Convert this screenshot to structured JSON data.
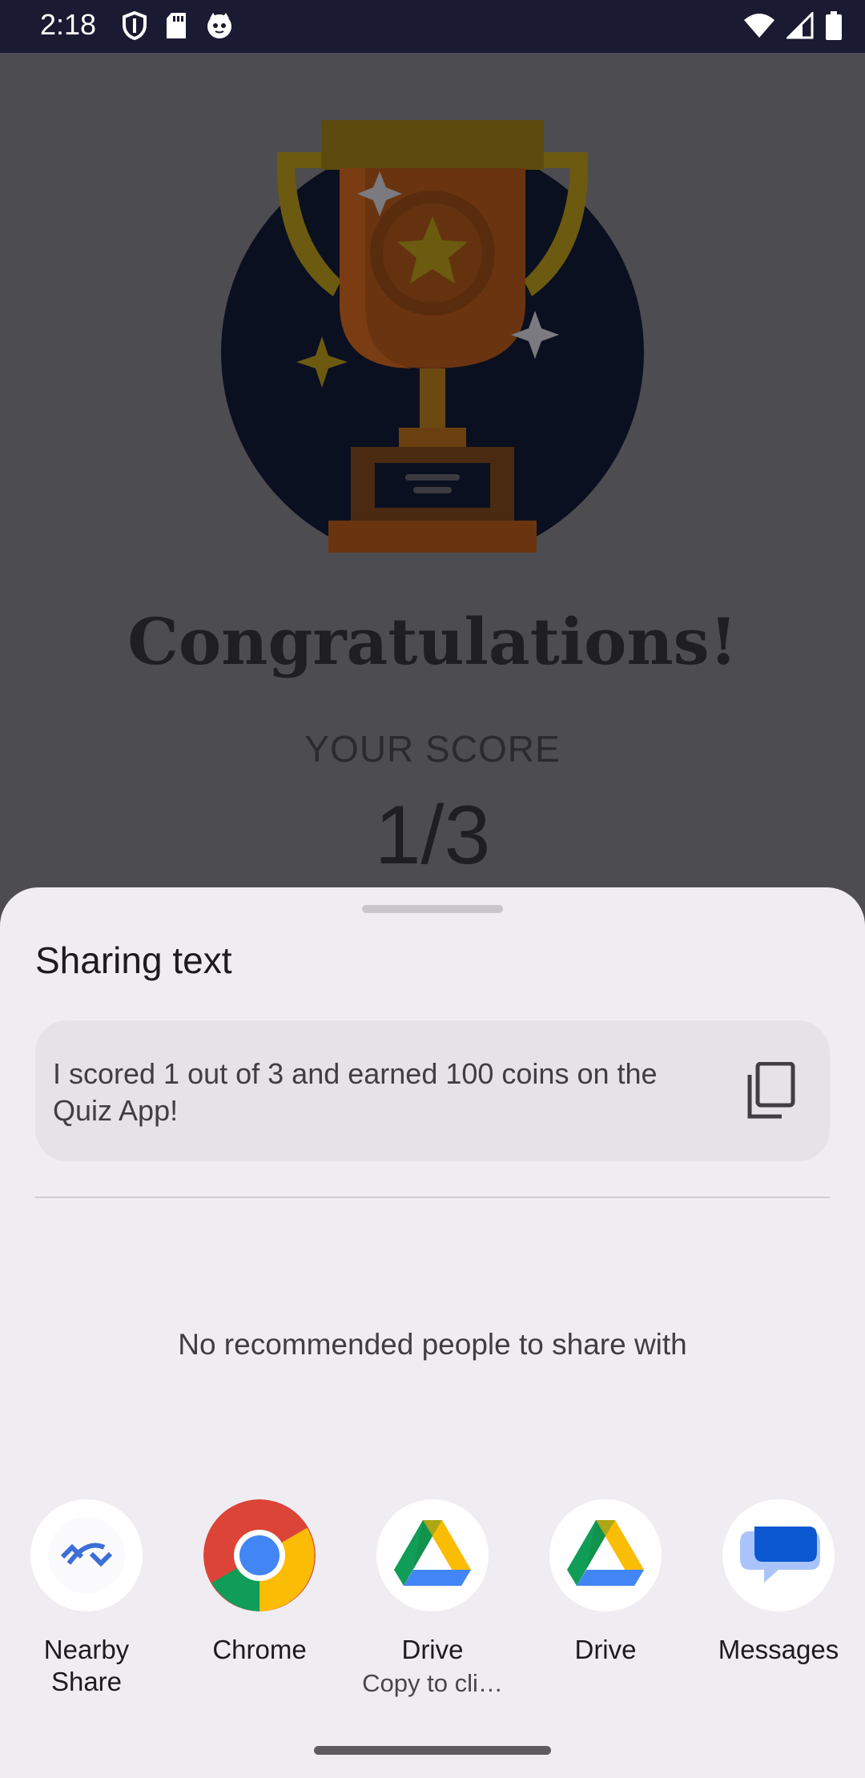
{
  "status_bar": {
    "time": "2:18"
  },
  "background_app": {
    "title": "Congratulations!",
    "score_label": "YOUR SCORE",
    "score_value": "1/3"
  },
  "share_sheet": {
    "title": "Sharing text",
    "preview_text": "I scored 1 out of 3 and earned 100 coins on the Quiz App!",
    "empty_people": "No recommended people to share with",
    "targets": [
      {
        "label": "Nearby Share",
        "sublabel": "",
        "icon": "nearby-share-icon"
      },
      {
        "label": "Chrome",
        "sublabel": "",
        "icon": "chrome-icon"
      },
      {
        "label": "Drive",
        "sublabel": "Copy to cli…",
        "icon": "drive-icon"
      },
      {
        "label": "Drive",
        "sublabel": "",
        "icon": "drive-icon"
      },
      {
        "label": "Messages",
        "sublabel": "",
        "icon": "messages-icon"
      }
    ]
  }
}
